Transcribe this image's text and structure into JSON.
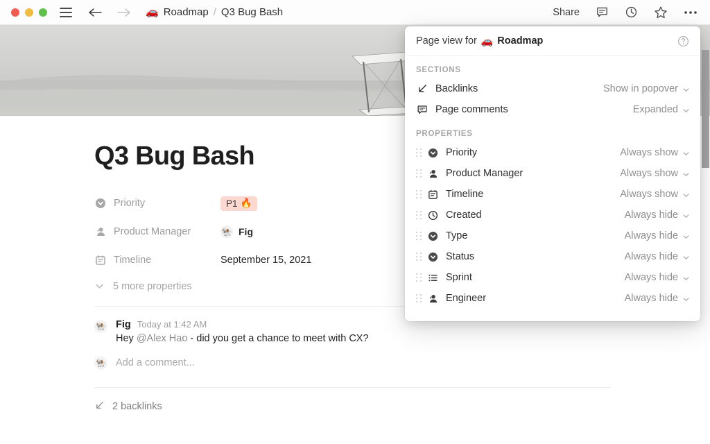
{
  "titlebar": {
    "window_controls": [
      "close",
      "minimize",
      "maximize"
    ],
    "menu_icon": "hamburger-icon",
    "back_icon": "arrow-left-icon",
    "forward_icon": "arrow-right-icon",
    "breadcrumb": {
      "emoji": "🚗",
      "parent": "Roadmap",
      "separator": "/",
      "current": "Q3 Bug Bash"
    },
    "share_label": "Share",
    "right_icons": [
      "comment-icon",
      "clock-icon",
      "star-icon",
      "more-icon"
    ]
  },
  "page": {
    "title": "Q3 Bug Bash",
    "properties": [
      {
        "icon": "select-icon",
        "name": "Priority",
        "value_type": "badge",
        "value": "P1",
        "value_emoji": "🔥",
        "badge_bg": "#fcd9d0"
      },
      {
        "icon": "person-icon",
        "name": "Product Manager",
        "value_type": "person",
        "value": "Fig",
        "avatar_emoji": "🐏"
      },
      {
        "icon": "calendar-icon",
        "name": "Timeline",
        "value_type": "text",
        "value": "September 15, 2021"
      }
    ],
    "more_properties_label": "5 more properties",
    "comment": {
      "avatar_emoji": "🐏",
      "author": "Fig",
      "timestamp": "Today at 1:42 AM",
      "text_before": "Hey ",
      "mention": "@Alex Hao",
      "text_after": " - did you get a chance to meet with CX?"
    },
    "add_comment_placeholder": "Add a comment...",
    "add_comment_avatar_emoji": "🐏",
    "backlinks_label": "2 backlinks"
  },
  "popover": {
    "header": {
      "prefix": "Page view for",
      "emoji": "🚗",
      "target": "Roadmap",
      "help_icon": "help-circle-icon"
    },
    "sections_label": "SECTIONS",
    "sections": [
      {
        "icon": "backlink-arrow-icon",
        "label": "Backlinks",
        "value": "Show in popover"
      },
      {
        "icon": "comment-icon",
        "label": "Page comments",
        "value": "Expanded"
      }
    ],
    "properties_label": "PROPERTIES",
    "properties": [
      {
        "icon": "select-icon",
        "label": "Priority",
        "value": "Always show"
      },
      {
        "icon": "person-icon",
        "label": "Product Manager",
        "value": "Always show"
      },
      {
        "icon": "calendar-icon",
        "label": "Timeline",
        "value": "Always show"
      },
      {
        "icon": "clock-icon",
        "label": "Created",
        "value": "Always hide"
      },
      {
        "icon": "select-icon",
        "label": "Type",
        "value": "Always hide"
      },
      {
        "icon": "select-icon",
        "label": "Status",
        "value": "Always hide"
      },
      {
        "icon": "list-icon",
        "label": "Sprint",
        "value": "Always hide"
      },
      {
        "icon": "person-icon",
        "label": "Engineer",
        "value": "Always hide"
      }
    ]
  },
  "colors": {
    "accent_badge": "#fcd9d0",
    "text_primary": "#232323",
    "text_muted": "#8f8f8f",
    "popover_bg": "#ffffff"
  }
}
